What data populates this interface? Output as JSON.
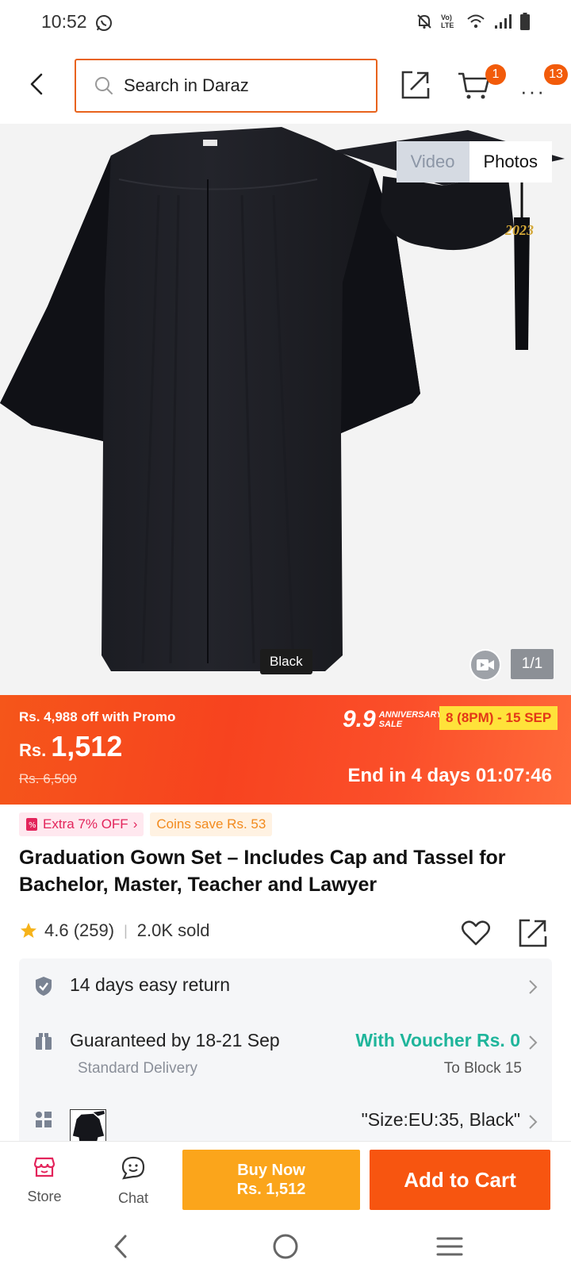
{
  "status_bar": {
    "time": "10:52",
    "volte_label": "Vo) LTE"
  },
  "header": {
    "search_placeholder": "Search in Daraz",
    "cart_count": "1",
    "more_count": "13"
  },
  "gallery": {
    "media_tabs": [
      "Video",
      "Photos"
    ],
    "active_tab": "Photos",
    "variant_label": "Black",
    "counter": "1/1",
    "tassel_year": "2023"
  },
  "promo": {
    "off_text": "Rs. 4,988 off with Promo",
    "currency": "Rs.",
    "price": "1,512",
    "original_price": "Rs. 6,500",
    "sale_logo_num": "9.9",
    "sale_logo_text": "ANNIVERSARY SALE",
    "sale_dates": "8 (8PM) - 15 SEP",
    "countdown": "End in 4 days 01:07:46",
    "colors": {
      "start": "#f5561a",
      "end": "#ff6a3a",
      "date_bg": "#ffe23a"
    }
  },
  "chips": {
    "extra_off": "Extra 7% OFF",
    "coins": "Coins save Rs. 53"
  },
  "product": {
    "title": "Graduation Gown Set – Includes Cap and Tassel for Bachelor, Master, Teacher and Lawyer",
    "rating": "4.6 (259)",
    "sold": "2.0K sold"
  },
  "info": {
    "return": "14 days easy return",
    "delivery": "Guaranteed by 18-21 Sep",
    "delivery_type": "Standard Delivery",
    "voucher": "With Voucher Rs. 0",
    "destination": "To Block 15",
    "variant": "\"Size:EU:35, Black\""
  },
  "bottom_bar": {
    "store": "Store",
    "chat": "Chat",
    "buy_now": "Buy Now",
    "buy_now_price": "Rs. 1,512",
    "add_to_cart": "Add to Cart",
    "colors": {
      "buy": "#fba51b",
      "cart": "#f75510"
    }
  }
}
